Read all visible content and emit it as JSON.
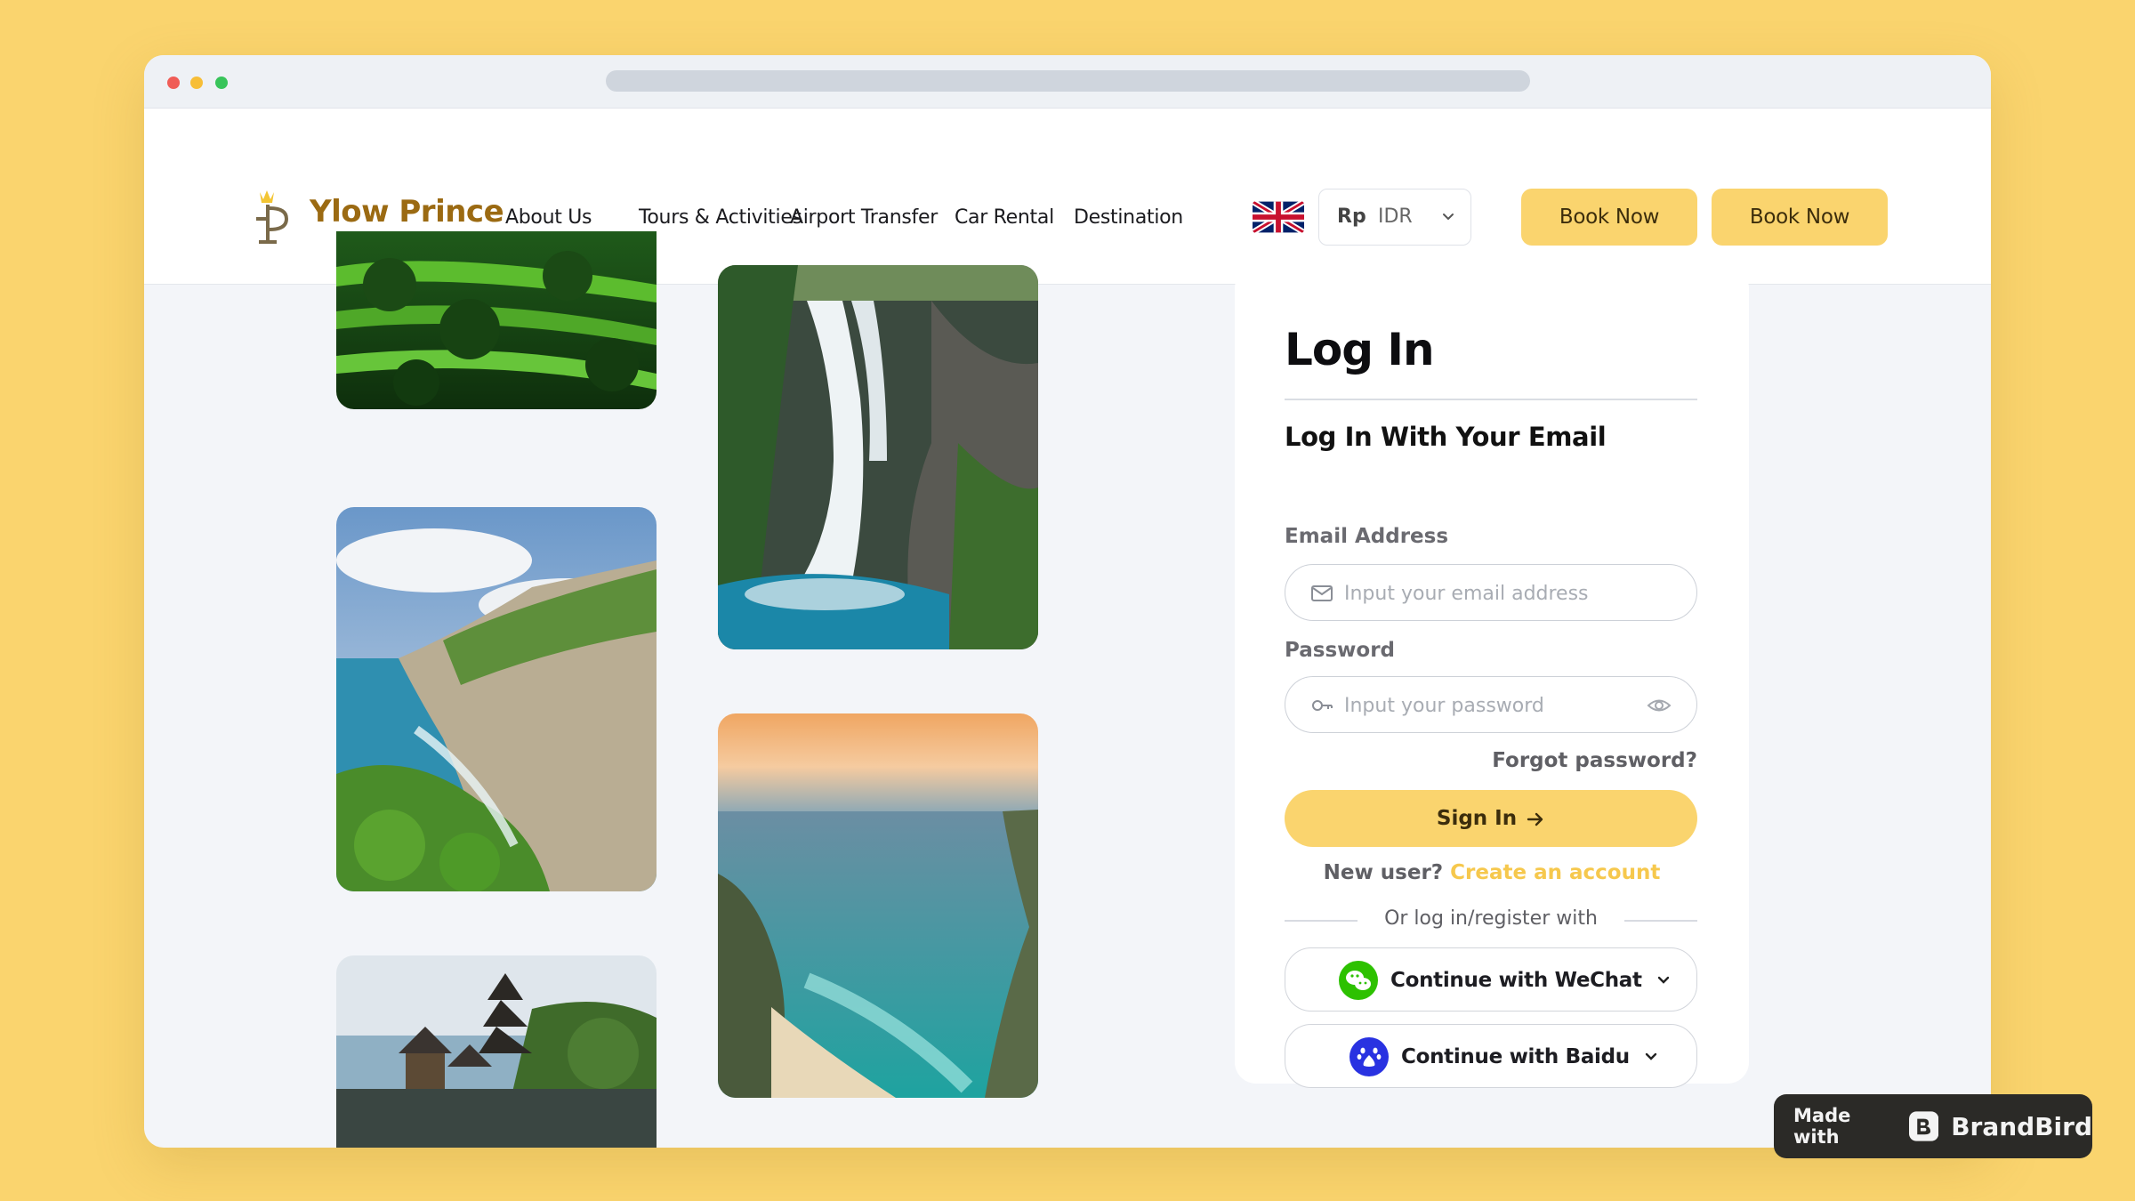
{
  "header": {
    "brand": "Ylow Prince",
    "nav": [
      "About Us",
      "Tours & Activities",
      "Airport Transfer",
      "Car Rental",
      "Destination"
    ],
    "currency": {
      "symbol": "Rp",
      "code": "IDR"
    },
    "book_buttons": [
      "Book Now",
      "Book Now"
    ]
  },
  "login": {
    "title": "Log In",
    "subtitle": "Log In With Your Email",
    "email_label": "Email Address",
    "email_placeholder": "Input your email address",
    "password_label": "Password",
    "password_placeholder": "Input your password",
    "forgot": "Forgot password?",
    "signin": "Sign In",
    "new_user": "New user?",
    "create_account": "Create an account",
    "divider": "Or log in/register with",
    "wechat": "Continue with WeChat",
    "baidu": "Continue with Baidu"
  },
  "badge": {
    "prefix": "Made with",
    "name": "BrandBird"
  },
  "icons": [
    "logo-icon",
    "uk-flag-icon",
    "chevron-down-icon",
    "mail-icon",
    "key-icon",
    "eye-icon",
    "arrow-right-icon",
    "wechat-icon",
    "baidu-icon",
    "brandbird-icon"
  ],
  "colors": {
    "accent": "#fad46e",
    "brand": "#9b6a12",
    "link": "#f6c84d",
    "background": "#f3f5f9"
  }
}
